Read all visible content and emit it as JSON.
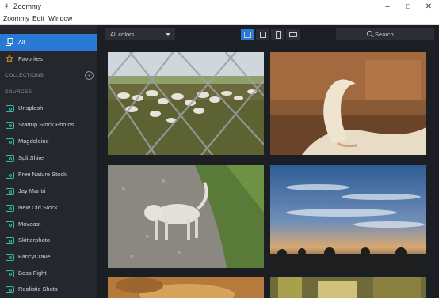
{
  "window": {
    "title": "Zoommy"
  },
  "menu": {
    "items": [
      "Zoommy",
      "Edit",
      "Window"
    ]
  },
  "sidebar": {
    "top_items": [
      {
        "label": "All",
        "icon": "copy-icon",
        "active": true
      },
      {
        "label": "Favorites",
        "icon": "star-icon",
        "active": false
      }
    ],
    "collections_header": "COLLECTIONS",
    "sources_header": "SOURCES",
    "sources": [
      "Unsplash",
      "Startup Stock Photos",
      "Magdeleine",
      "SplitShire",
      "Free Nature Stock",
      "Jay Mantri",
      "New Old Stock",
      "Moveast",
      "Skitterphoto",
      "FancyCrave",
      "Boss Fight",
      "Realistic Shots"
    ]
  },
  "toolbar": {
    "color_filter": "All colors",
    "search_label": "Search"
  },
  "photos": [
    {
      "subject": "sheep-behind-fence"
    },
    {
      "subject": "dog-tail-closeup"
    },
    {
      "subject": "white-dog-on-path"
    },
    {
      "subject": "sunset-sky"
    },
    {
      "subject": "blurred-animal"
    },
    {
      "subject": "blurred-interior"
    }
  ],
  "colors": {
    "accent": "#2a79d4",
    "source_icon": "#35b8a8",
    "favorite_icon": "#e0902a"
  }
}
